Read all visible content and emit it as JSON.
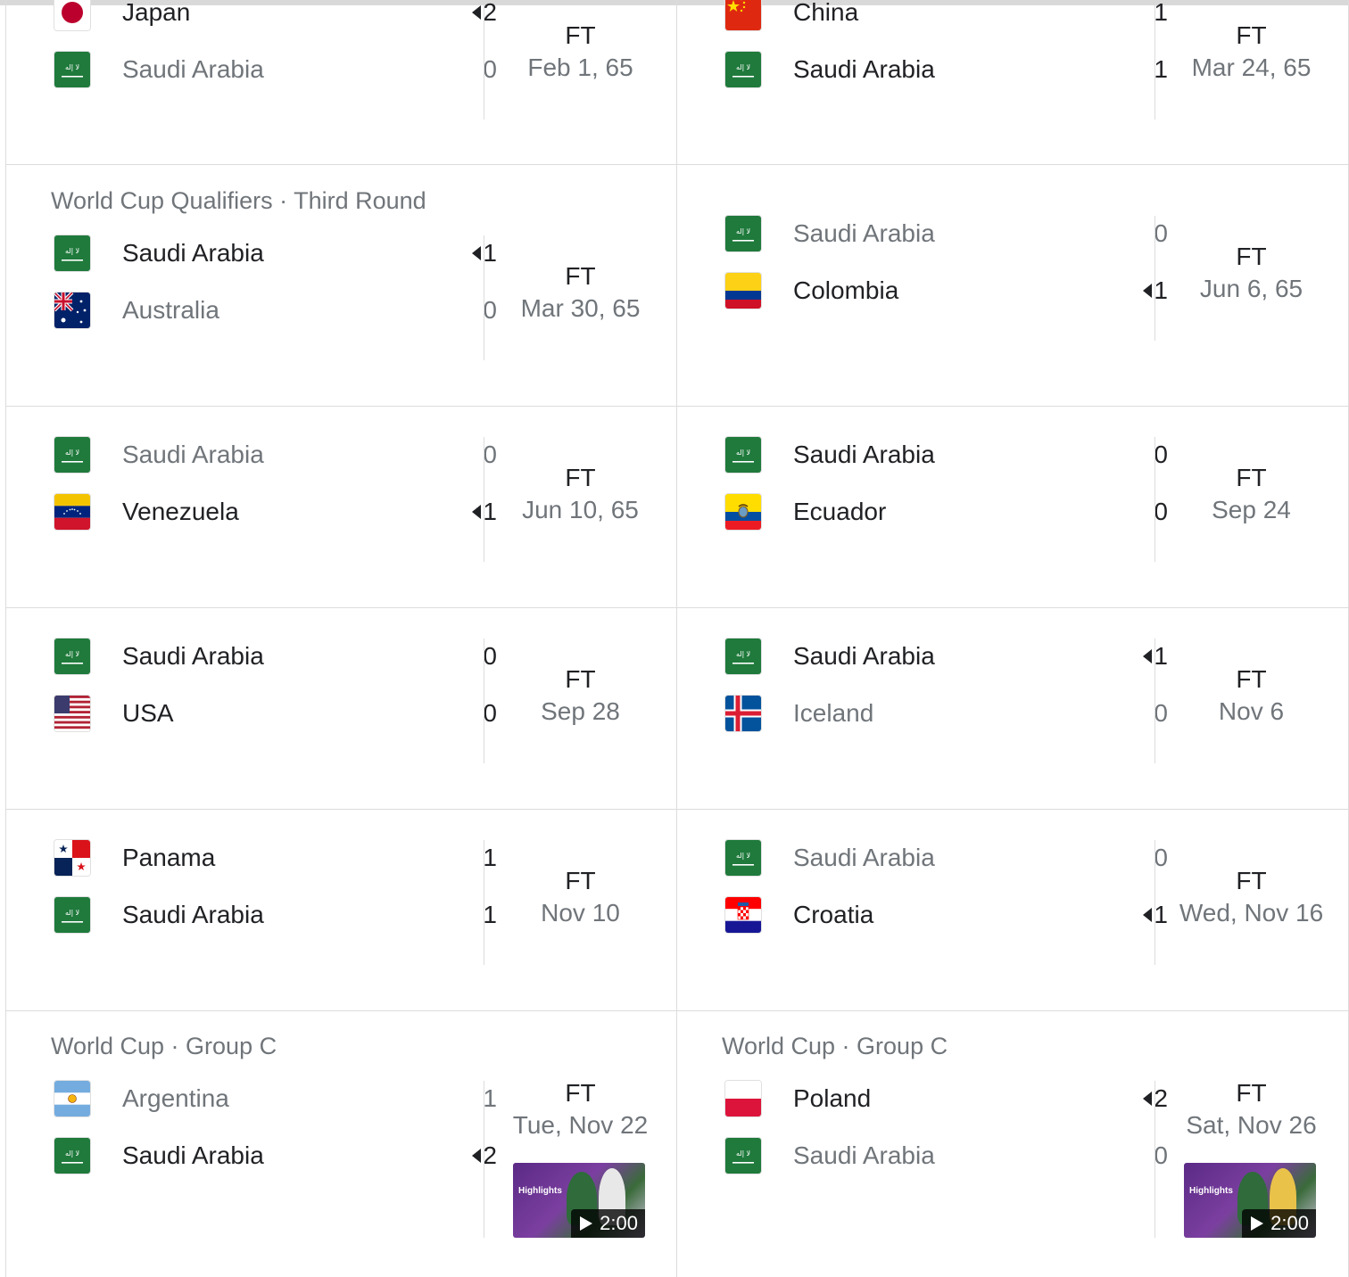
{
  "matches": [
    {
      "competition": "",
      "home": {
        "name": "Japan",
        "score": "2",
        "flag": "japan-flag"
      },
      "away": {
        "name": "Saudi Arabia",
        "score": "0",
        "flag": "saudi-flag"
      },
      "winner": "home",
      "status": "FT",
      "date": "Feb 1, 65"
    },
    {
      "competition": "",
      "home": {
        "name": "China",
        "score": "1",
        "flag": "china-flag"
      },
      "away": {
        "name": "Saudi Arabia",
        "score": "1",
        "flag": "saudi-flag"
      },
      "winner": "draw",
      "status": "FT",
      "date": "Mar 24, 65"
    },
    {
      "competition": "World Cup Qualifiers · Third Round",
      "home": {
        "name": "Saudi Arabia",
        "score": "1",
        "flag": "saudi-flag"
      },
      "away": {
        "name": "Australia",
        "score": "0",
        "flag": "australia-flag"
      },
      "winner": "home",
      "status": "FT",
      "date": "Mar 30, 65"
    },
    {
      "competition": "",
      "home": {
        "name": "Saudi Arabia",
        "score": "0",
        "flag": "saudi-flag"
      },
      "away": {
        "name": "Colombia",
        "score": "1",
        "flag": "colombia-flag"
      },
      "winner": "away",
      "status": "FT",
      "date": "Jun 6, 65"
    },
    {
      "competition": "",
      "home": {
        "name": "Saudi Arabia",
        "score": "0",
        "flag": "saudi-flag"
      },
      "away": {
        "name": "Venezuela",
        "score": "1",
        "flag": "venezuela-flag"
      },
      "winner": "away",
      "status": "FT",
      "date": "Jun 10, 65"
    },
    {
      "competition": "",
      "home": {
        "name": "Saudi Arabia",
        "score": "0",
        "flag": "saudi-flag"
      },
      "away": {
        "name": "Ecuador",
        "score": "0",
        "flag": "ecuador-flag"
      },
      "winner": "draw",
      "status": "FT",
      "date": "Sep 24"
    },
    {
      "competition": "",
      "home": {
        "name": "Saudi Arabia",
        "score": "0",
        "flag": "saudi-flag"
      },
      "away": {
        "name": "USA",
        "score": "0",
        "flag": "usa-flag"
      },
      "winner": "draw",
      "status": "FT",
      "date": "Sep 28"
    },
    {
      "competition": "",
      "home": {
        "name": "Saudi Arabia",
        "score": "1",
        "flag": "saudi-flag"
      },
      "away": {
        "name": "Iceland",
        "score": "0",
        "flag": "iceland-flag"
      },
      "winner": "home",
      "status": "FT",
      "date": "Nov 6"
    },
    {
      "competition": "",
      "home": {
        "name": "Panama",
        "score": "1",
        "flag": "panama-flag"
      },
      "away": {
        "name": "Saudi Arabia",
        "score": "1",
        "flag": "saudi-flag"
      },
      "winner": "draw",
      "status": "FT",
      "date": "Nov 10"
    },
    {
      "competition": "",
      "home": {
        "name": "Saudi Arabia",
        "score": "0",
        "flag": "saudi-flag"
      },
      "away": {
        "name": "Croatia",
        "score": "1",
        "flag": "croatia-flag"
      },
      "winner": "away",
      "status": "FT",
      "date": "Wed, Nov 16"
    },
    {
      "competition": "World Cup · Group C",
      "home": {
        "name": "Argentina",
        "score": "1",
        "flag": "argentina-flag"
      },
      "away": {
        "name": "Saudi Arabia",
        "score": "2",
        "flag": "saudi-flag"
      },
      "winner": "away",
      "status": "FT",
      "date": "Tue, Nov 22",
      "highlights": {
        "label": "Highlights",
        "duration": "2:00"
      }
    },
    {
      "competition": "World Cup · Group C",
      "home": {
        "name": "Poland",
        "score": "2",
        "flag": "poland-flag"
      },
      "away": {
        "name": "Saudi Arabia",
        "score": "0",
        "flag": "saudi-flag"
      },
      "winner": "home",
      "status": "FT",
      "date": "Sat, Nov 26",
      "highlights": {
        "label": "Highlights",
        "duration": "2:00"
      }
    }
  ]
}
